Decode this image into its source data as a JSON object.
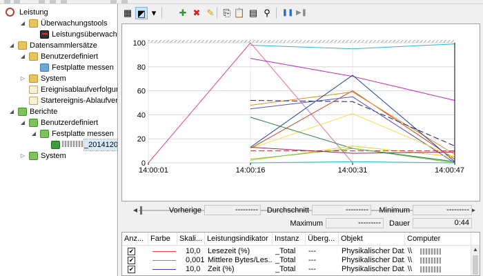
{
  "tree": {
    "items": [
      {
        "name": "tree-item-leistung",
        "label": "Leistung",
        "icon": "performance-icon",
        "level": 0,
        "expander": ""
      },
      {
        "name": "tree-item-ueberwachungstools",
        "label": "Überwachungstools",
        "icon": "folder-icon",
        "level": 1,
        "expander": "◢"
      },
      {
        "name": "tree-item-leistungsueberwachung",
        "label": "Leistungsüberwachung",
        "icon": "monitor-icon",
        "level": 2,
        "expander": ""
      },
      {
        "name": "tree-item-datensammlersaetze",
        "label": "Datensammlersätze",
        "icon": "folder-icon",
        "level": 0,
        "expander": "◢"
      },
      {
        "name": "tree-item-benutzerdefiniert-1",
        "label": "Benutzerdefiniert",
        "icon": "folder-icon",
        "level": 1,
        "expander": "◢"
      },
      {
        "name": "tree-item-festplatte-messen-1",
        "label": "Festplatte messen",
        "icon": "disk-icon",
        "level": 2,
        "expander": ""
      },
      {
        "name": "tree-item-system-1",
        "label": "System",
        "icon": "folder-icon",
        "level": 1,
        "expander": "▷"
      },
      {
        "name": "tree-item-ereignisablaufverfolgung",
        "label": "Ereignisablaufverfolgur",
        "icon": "document-icon",
        "level": 1,
        "expander": ""
      },
      {
        "name": "tree-item-startereignis",
        "label": "Startereignis-Ablaufver",
        "icon": "document-icon",
        "level": 1,
        "expander": ""
      },
      {
        "name": "tree-item-berichte",
        "label": "Berichte",
        "icon": "report-folder-icon",
        "level": 0,
        "expander": "◢"
      },
      {
        "name": "tree-item-benutzerdefiniert-2",
        "label": "Benutzerdefiniert",
        "icon": "report-folder-icon",
        "level": 1,
        "expander": "◢"
      },
      {
        "name": "tree-item-festplatte-messen-2",
        "label": "Festplatte messen",
        "icon": "report-folder-icon",
        "level": 2,
        "expander": "◢"
      },
      {
        "name": "tree-item-report-2014120",
        "label": "_2014120",
        "icon": "report-icon",
        "level": 3,
        "expander": "",
        "selected": true
      },
      {
        "name": "tree-item-system-2",
        "label": "System",
        "icon": "report-folder-icon",
        "level": 1,
        "expander": "▷"
      }
    ]
  },
  "toolbar": {
    "buttons": [
      {
        "name": "change-graph-type-icon",
        "glyph": "▦"
      },
      {
        "name": "view-current-activity-icon",
        "glyph": "◩"
      },
      {
        "name": "graph-type-dropdown-icon",
        "glyph": "▾"
      },
      {
        "name": "add-counter-icon",
        "glyph": "✚",
        "color": "#2e9b2e"
      },
      {
        "name": "delete-counter-icon",
        "glyph": "✖",
        "color": "#d62020"
      },
      {
        "name": "highlight-icon",
        "glyph": "✎",
        "color": "#c89b1a"
      },
      {
        "name": "copy-properties-icon",
        "glyph": "⎘"
      },
      {
        "name": "paste-counter-list-icon",
        "glyph": "📋"
      },
      {
        "name": "properties-icon",
        "glyph": "▤"
      },
      {
        "name": "zoom-icon",
        "glyph": "⚲"
      },
      {
        "name": "pause-icon",
        "glyph": "❚❚",
        "color": "#1f6fc5"
      },
      {
        "name": "next-icon",
        "glyph": "▶❚",
        "color": "#888888"
      }
    ]
  },
  "chart_data": {
    "type": "line",
    "x": [
      "14:00:01",
      "14:00:16",
      "14:00:31",
      "14:00:47"
    ],
    "ylim": [
      0,
      100
    ],
    "yticks": [
      "0",
      "20",
      "40",
      "60",
      "80",
      "100"
    ],
    "grid": true,
    "series": [
      {
        "color": "#e0408a",
        "values": [
          0,
          100,
          null,
          null
        ]
      },
      {
        "color": "#e06ca8",
        "values": [
          null,
          100,
          0,
          null
        ]
      },
      {
        "color": "#28b4d8",
        "values": [
          null,
          98,
          95,
          99
        ]
      },
      {
        "color": "#c020c0",
        "values": [
          null,
          87,
          72,
          52
        ]
      },
      {
        "color": "#d04020",
        "values": [
          null,
          12,
          60,
          3
        ]
      },
      {
        "color": "#e09020",
        "values": [
          null,
          48,
          59,
          7
        ]
      },
      {
        "color": "#2040a0",
        "values": [
          null,
          13,
          73,
          1
        ]
      },
      {
        "color": "#102070",
        "values": [
          null,
          52,
          51,
          14
        ],
        "dashed": true
      },
      {
        "color": "#5050c0",
        "values": [
          null,
          45,
          55,
          0
        ]
      },
      {
        "color": "#f0e040",
        "values": [
          null,
          12,
          41,
          5
        ]
      },
      {
        "color": "#208040",
        "values": [
          null,
          38,
          12,
          1
        ]
      },
      {
        "color": "#e8d020",
        "values": [
          null,
          2,
          14,
          5
        ]
      },
      {
        "color": "#b03030",
        "values": [
          null,
          10,
          10,
          10
        ],
        "dashed": true
      },
      {
        "color": "#20c0c0",
        "values": [
          null,
          0,
          1,
          0
        ]
      },
      {
        "color": "#70c040",
        "values": [
          null,
          3,
          12,
          0
        ]
      },
      {
        "color": "#a02060",
        "values": [
          null,
          13,
          8,
          9
        ]
      }
    ]
  },
  "stats": {
    "vorherige_label": "Vorherige",
    "vorherige_value": "---------",
    "durchschnitt_label": "Durchschnitt",
    "durchschnitt_value": "---------",
    "minimum_label": "Minimum",
    "minimum_value": "---------",
    "maximum_label": "Maximum",
    "maximum_value": "---------",
    "dauer_label": "Dauer",
    "dauer_value": "0:44"
  },
  "counter_list": {
    "headers": [
      "Anz...",
      "Farbe",
      "Skali...",
      "Leistungsindikator",
      "Instanz",
      "Überg...",
      "Objekt",
      "Computer"
    ],
    "rows": [
      {
        "checked": "✔",
        "color": "#e04040",
        "scale": "10,0",
        "counter": "Lesezeit (%)",
        "instance": "_Total",
        "parent": "---",
        "object": "Physikalischer Dat...",
        "computer": "\\\\"
      },
      {
        "checked": "✔",
        "color": "#40b040",
        "scale": "0,001",
        "counter": "Mittlere Bytes/Les...",
        "instance": "_Total",
        "parent": "---",
        "object": "Physikalischer Dat...",
        "computer": "\\\\"
      },
      {
        "checked": "✔",
        "color": "#3040c0",
        "scale": "10,0",
        "counter": "Zeit (%)",
        "instance": "_Total",
        "parent": "---",
        "object": "Physikalischer Dat...",
        "computer": "\\\\"
      }
    ]
  }
}
